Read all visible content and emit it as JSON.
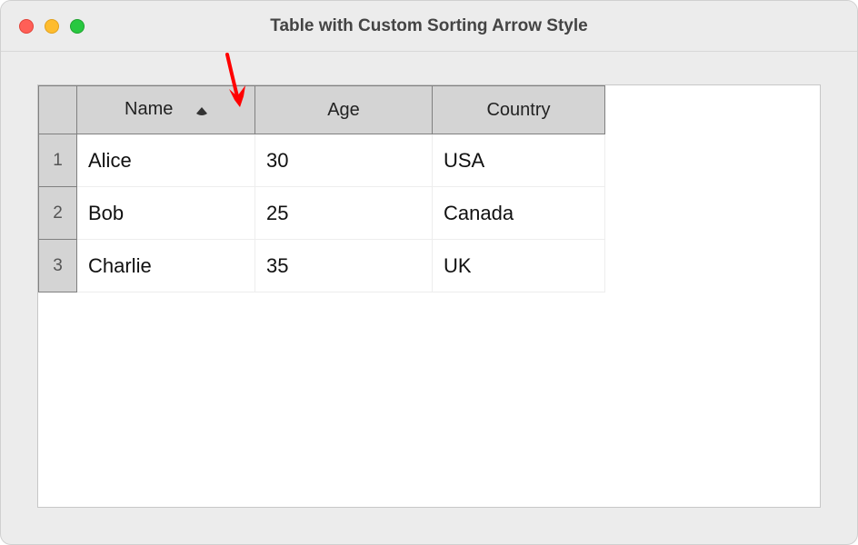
{
  "window": {
    "title": "Table with Custom Sorting Arrow Style"
  },
  "table": {
    "columns": [
      {
        "label": "Name"
      },
      {
        "label": "Age"
      },
      {
        "label": "Country"
      }
    ],
    "row_headers": [
      "1",
      "2",
      "3"
    ],
    "rows": [
      {
        "name": "Alice",
        "age": "30",
        "country": "USA"
      },
      {
        "name": "Bob",
        "age": "25",
        "country": "Canada"
      },
      {
        "name": "Charlie",
        "age": "35",
        "country": "UK"
      }
    ],
    "sorted_column": 0,
    "sort_direction": "asc"
  }
}
